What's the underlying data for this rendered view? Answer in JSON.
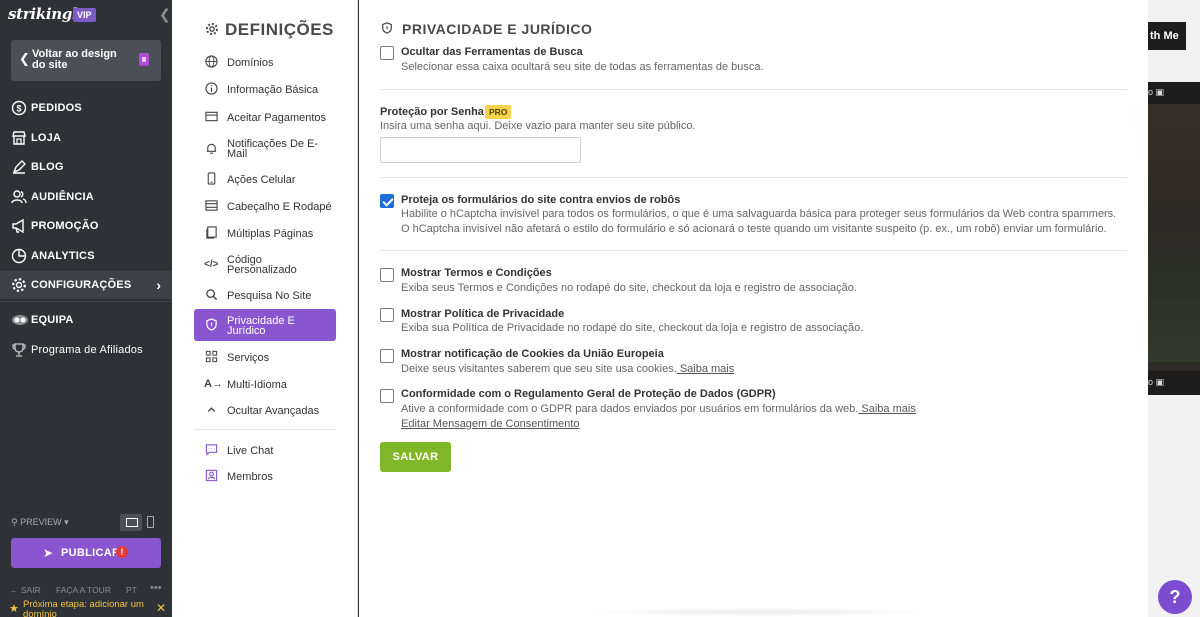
{
  "sidebar": {
    "logo": "strikingly",
    "vip_badge": "VIP",
    "collapse_icon": "chevron-left-icon",
    "back_button": "Voltar ao design do site",
    "nav": [
      {
        "label": "PEDIDOS",
        "icon": "dollar-icon"
      },
      {
        "label": "LOJA",
        "icon": "store-icon"
      },
      {
        "label": "BLOG",
        "icon": "pen-icon"
      },
      {
        "label": "AUDIÊNCIA",
        "icon": "users-icon"
      },
      {
        "label": "PROMOÇÃO",
        "icon": "megaphone-icon"
      },
      {
        "label": "ANALYTICS",
        "icon": "chart-icon"
      },
      {
        "label": "CONFIGURAÇÕES",
        "icon": "gear-icon"
      },
      {
        "label": "EQUIPA",
        "icon": "team-icon"
      },
      {
        "label": "Programa de Afiliados",
        "icon": "trophy-icon"
      }
    ],
    "preview_label": "PREVIEW",
    "publish_label": "PUBLICAR",
    "publish_alert": "!",
    "footer": {
      "sair": "SAIR",
      "tour": "FAÇA A TOUR",
      "lang": "PT",
      "more": "•••"
    },
    "next_step": "Próxima etapa: adicionar um domínio"
  },
  "background": {
    "top_button": "th Me"
  },
  "settings_nav": {
    "title": "DEFINIÇÕES",
    "items": [
      {
        "label": "Domínios",
        "icon": "globe-icon"
      },
      {
        "label": "Informação Básica",
        "icon": "info-icon"
      },
      {
        "label": "Aceitar Pagamentos",
        "icon": "card-icon"
      },
      {
        "label": "Notificações De E-Mail",
        "icon": "bell-icon"
      },
      {
        "label": "Ações Celular",
        "icon": "phone-icon"
      },
      {
        "label": "Cabeçalho E Rodapé",
        "icon": "layout-icon"
      },
      {
        "label": "Múltiplas Páginas",
        "icon": "pages-icon"
      },
      {
        "label": "Código Personalizado",
        "icon": "code-icon"
      },
      {
        "label": "Pesquisa No Site",
        "icon": "search-icon"
      },
      {
        "label": "Privacidade E Jurídico",
        "icon": "shield-icon"
      },
      {
        "label": "Serviços",
        "icon": "grid-icon"
      },
      {
        "label": "Multi-Idioma",
        "icon": "translate-icon"
      },
      {
        "label": "Ocultar Avançadas",
        "icon": "chevron-up-icon"
      },
      {
        "label": "Live Chat",
        "icon": "chat-icon"
      },
      {
        "label": "Membros",
        "icon": "member-icon"
      }
    ]
  },
  "main": {
    "title": "PRIVACIDADE E JURÍDICO",
    "hide_search": {
      "title": "Ocultar das Ferramentas de Busca",
      "desc": "Selecionar essa caixa ocultará seu site de todas as ferramentas de busca.",
      "checked": false
    },
    "password": {
      "title": "Proteção por Senha",
      "badge": "PRO",
      "desc": "Insira uma senha aqui. Deixe vazio para manter seu site público.",
      "value": ""
    },
    "hcaptcha": {
      "title": "Proteja os formulários do site contra envios de robôs",
      "desc": "Habilite o hCaptcha invisível para todos os formulários, o que é uma salvaguarda básica para proteger seus formulários da Web contra spammers. O hCaptcha invisível não afetará o estilo do formulário e só acionará o teste quando um visitante suspeito (p. ex., um robô) enviar um formulário.",
      "checked": true
    },
    "terms": {
      "title": "Mostrar Termos e Condições",
      "desc": "Exiba seus Termos e Condições no rodapé do site, checkout da loja e registro de associação.",
      "checked": false
    },
    "privacy": {
      "title": "Mostrar Política de Privacidade",
      "desc": "Exiba sua Política de Privacidade no rodapé do site, checkout da loja e registro de associação.",
      "checked": false
    },
    "cookies": {
      "title": "Mostrar notificação de Cookies da União Europeia",
      "desc": "Deixe seus visitantes saberem que seu site usa cookies.",
      "link": " Saiba mais",
      "checked": false
    },
    "gdpr": {
      "title": "Conformidade com o Regulamento Geral de Proteção de Dados (GDPR)",
      "desc": "Ative a conformidade com o GDPR para dados enviados por usuários em formulários da web.",
      "link": " Saiba mais",
      "edit_link": "Editar Mensagem de Consentimento",
      "checked": false
    },
    "save_label": "SALVAR"
  },
  "help_label": "?",
  "colors": {
    "accent": "#8a56cf",
    "save": "#7fb728",
    "checkbox": "#1e6fd9",
    "sidebar": "#2e3135"
  }
}
